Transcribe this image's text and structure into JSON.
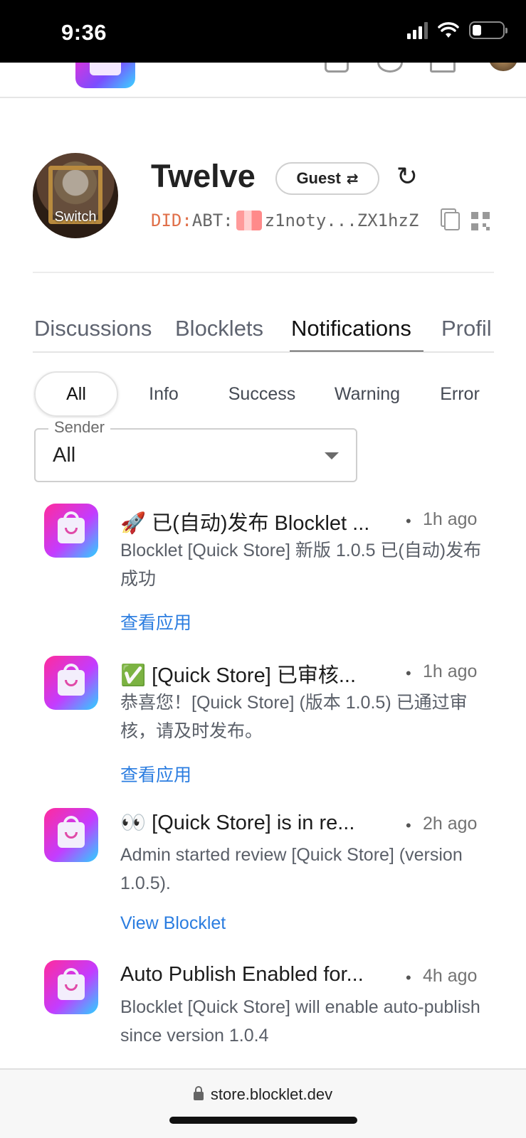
{
  "status": {
    "time": "9:36"
  },
  "profile": {
    "name": "Twelve",
    "avatar_label": "Switch",
    "role_chip": "Guest",
    "did_prefix": "DID:",
    "did_type": "ABT:",
    "did_value": "z1noty...ZX1hzZ"
  },
  "tabs": [
    "Discussions",
    "Blocklets",
    "Notifications",
    "Profil"
  ],
  "filters": [
    "All",
    "Info",
    "Success",
    "Warning",
    "Error"
  ],
  "sender": {
    "label": "Sender",
    "value": "All"
  },
  "notifications": [
    {
      "title": "🚀 已(自动)发布 Blocklet ...",
      "time": "1h ago",
      "body": "Blocklet [Quick Store] 新版 1.0.5 已(自动)发布成功",
      "link": "查看应用"
    },
    {
      "title": "✅ [Quick Store] 已审核...",
      "time": "1h ago",
      "body": "恭喜您！[Quick Store] (版本 1.0.5) 已通过审核，请及时发布。",
      "link": "查看应用"
    },
    {
      "title": "👀 [Quick Store] is in re...",
      "time": "2h ago",
      "body": "Admin started review [Quick Store] (version 1.0.5).",
      "link": "View Blocklet"
    },
    {
      "title": "Auto Publish Enabled for...",
      "time": "4h ago",
      "body": "Blocklet [Quick Store] will enable auto-publish since version 1.0.4",
      "link": ""
    }
  ],
  "browser": {
    "url": "store.blocklet.dev"
  }
}
